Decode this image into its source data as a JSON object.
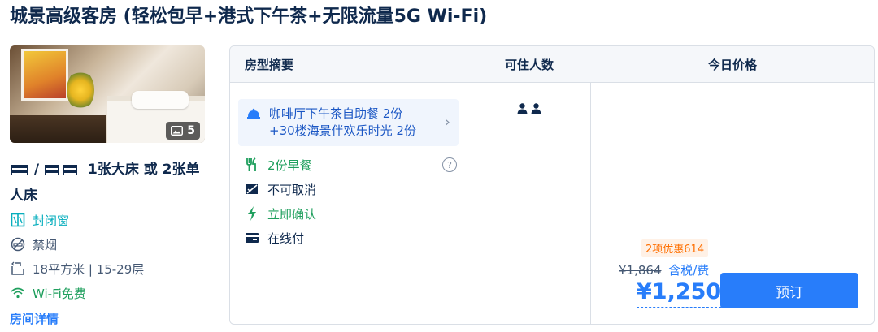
{
  "room": {
    "title": "城景高级客房 (轻松包早+港式下午茶+无限流量5G Wi-Fi)",
    "photo_count": "5",
    "bed_text": "1张大床 或 2张单人床",
    "bed_sep": "/",
    "features": [
      {
        "icon": "window-icon",
        "label": "封闭窗",
        "color": "#06aebd"
      },
      {
        "icon": "no-smoking-icon",
        "label": "禁烟",
        "color": "#455873"
      },
      {
        "icon": "area-icon",
        "label": "18平方米 | 15-29层",
        "color": "#455873"
      },
      {
        "icon": "wifi-icon",
        "label": "Wi-Fi免费",
        "color": "#1f9f5d"
      }
    ],
    "detail_link": "房间详情"
  },
  "table": {
    "headers": {
      "summary": "房型摘要",
      "occupancy": "可住人数",
      "price": "今日价格"
    },
    "promo": {
      "line1": "咖啡厅下午茶自助餐 2份",
      "line2": "+30楼海景伴欢乐时光 2份"
    },
    "package": [
      {
        "icon": "breakfast-icon",
        "label": "2份早餐",
        "color": "#1f9f5d"
      },
      {
        "icon": "no-cancel-icon",
        "label": "不可取消",
        "color": "#0f294d"
      },
      {
        "icon": "lightning-icon",
        "label": "立即确认",
        "color": "#1f9f5d"
      },
      {
        "icon": "card-icon",
        "label": "在线付",
        "color": "#0f294d"
      }
    ],
    "occupancy": 2,
    "pricing": {
      "discount_tag": "2项优惠614",
      "original_price": "¥1,864",
      "tax_note": "含税/费",
      "price": "¥1,250",
      "book_label": "预订"
    }
  }
}
